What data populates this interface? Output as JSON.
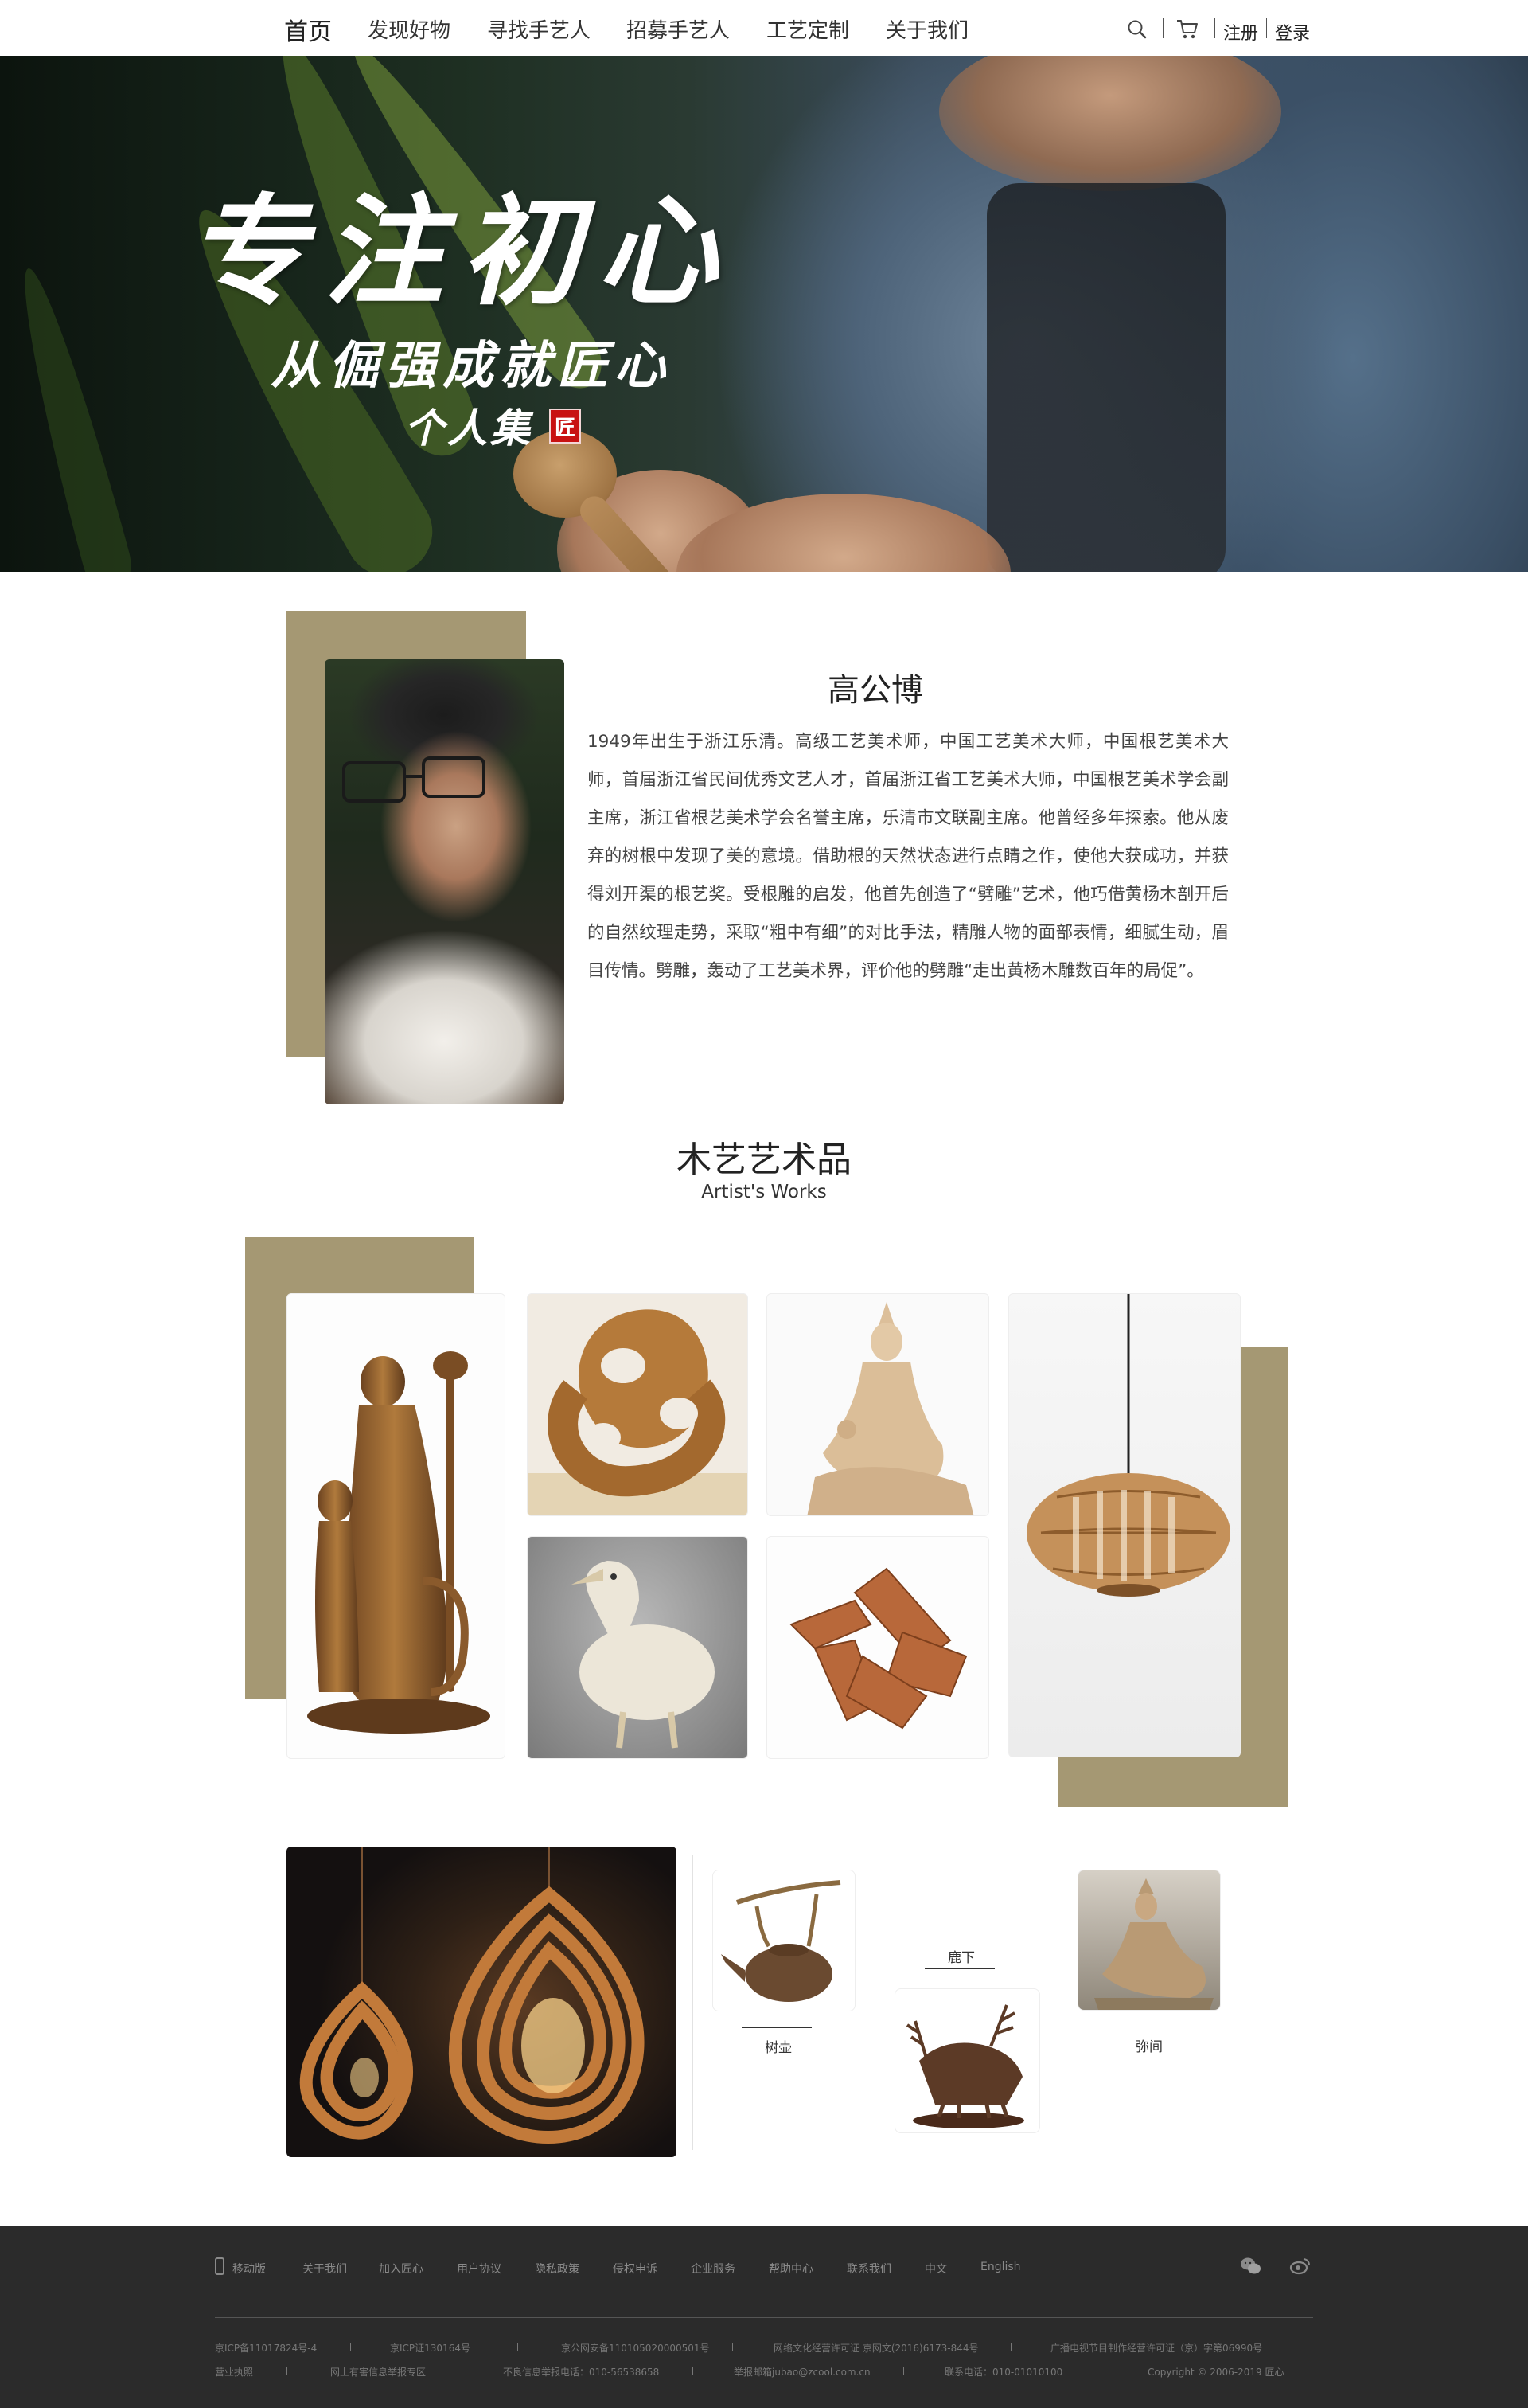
{
  "nav": {
    "items": [
      "首页",
      "发现好物",
      "寻找手艺人",
      "招募手艺人",
      "工艺定制",
      "关于我们"
    ],
    "register": "注册",
    "login": "登录",
    "search_icon": "search-icon",
    "cart_icon": "cart-icon"
  },
  "hero": {
    "line1": "专注初心",
    "line2": "从倔强成就匠心",
    "line3": "个人集",
    "seal": "匠"
  },
  "profile": {
    "name": "高公博",
    "bio": "1949年出生于浙江乐清。高级工艺美术师，中国工艺美术大师，中国根艺美术大师，首届浙江省民间优秀文艺人才，首届浙江省工艺美术大师，中国根艺美术学会副主席，浙江省根艺美术学会名誉主席，乐清市文联副主席。他曾经多年探索。他从废弃的树根中发现了美的意境。借助根的天然状态进行点睛之作，使他大获成功，并获得刘开渠的根艺奖。受根雕的启发，他首先创造了“劈雕”艺术，他巧借黄杨木剖开后的自然纹理走势，采取“粗中有细”的对比手法，精雕人物的面部表情，细腻生动，眉目传情。劈雕，轰动了工艺美术界，评价他的劈雕“走出黄杨木雕数百年的局促”。"
  },
  "works": {
    "title": "木艺艺术品",
    "subtitle": "Artist's Works",
    "small_items": [
      {
        "label": "树壶"
      },
      {
        "label": "鹿下"
      },
      {
        "label": "弥间"
      }
    ]
  },
  "colors": {
    "accent_gold": "#a59873",
    "footer_bg": "#2b2b2b",
    "seal_red": "#c81212"
  },
  "footer": {
    "links": [
      "移动版",
      "关于我们",
      "加入匠心",
      "用户协议",
      "隐私政策",
      "侵权申诉",
      "企业服务",
      "帮助中心",
      "联系我们",
      "中文",
      "English"
    ],
    "row1": [
      "京ICP备11017824号-4",
      "京ICP证130164号",
      "京公网安备110105020000501号",
      "网络文化经营许可证 京网文(2016)6173-844号",
      "广播电视节目制作经营许可证（京）字第06990号"
    ],
    "row2": [
      "营业执照",
      "网上有害信息举报专区",
      "不良信息举报电话：010-56538658",
      "举报邮箱jubao@zcool.com.cn",
      "联系电话：010-01010100",
      "Copyright © 2006-2019 匠心"
    ],
    "icons": [
      "wechat-icon",
      "weibo-icon"
    ]
  }
}
